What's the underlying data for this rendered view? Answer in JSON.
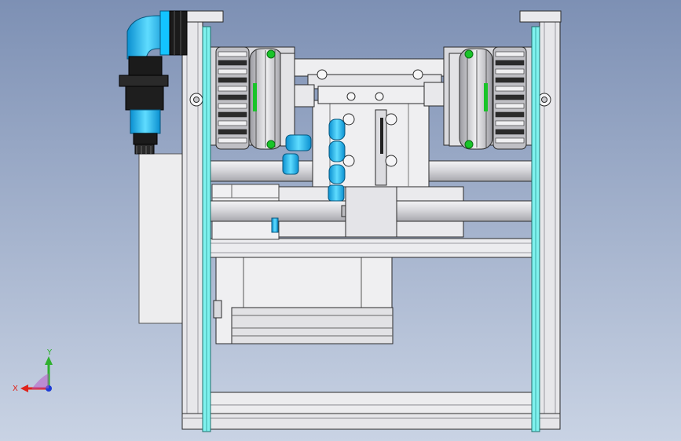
{
  "viewport": {
    "background_top": "#7d90b4",
    "background_bottom": "#c9d3e4"
  },
  "colors": {
    "steel_light": "#ececee",
    "steel_mid": "#c8c8cc",
    "steel_dark": "#8a8a90",
    "edge": "#2a2a2a",
    "cyan_rail": "#7ff2ee",
    "cyan_fitting": "#13c4ff",
    "cyan_fitting_dark": "#0a8fd0",
    "sensor_black": "#1b1b1b",
    "motor_dark": "#3a3a3a",
    "screw_green": "#19c429",
    "axis_x": "#e0231b",
    "axis_y": "#2fb02f",
    "axis_z": "#1c3bd6"
  },
  "triad": {
    "x_label": "X",
    "y_label": "Y",
    "icon": "axis-triad-icon"
  }
}
